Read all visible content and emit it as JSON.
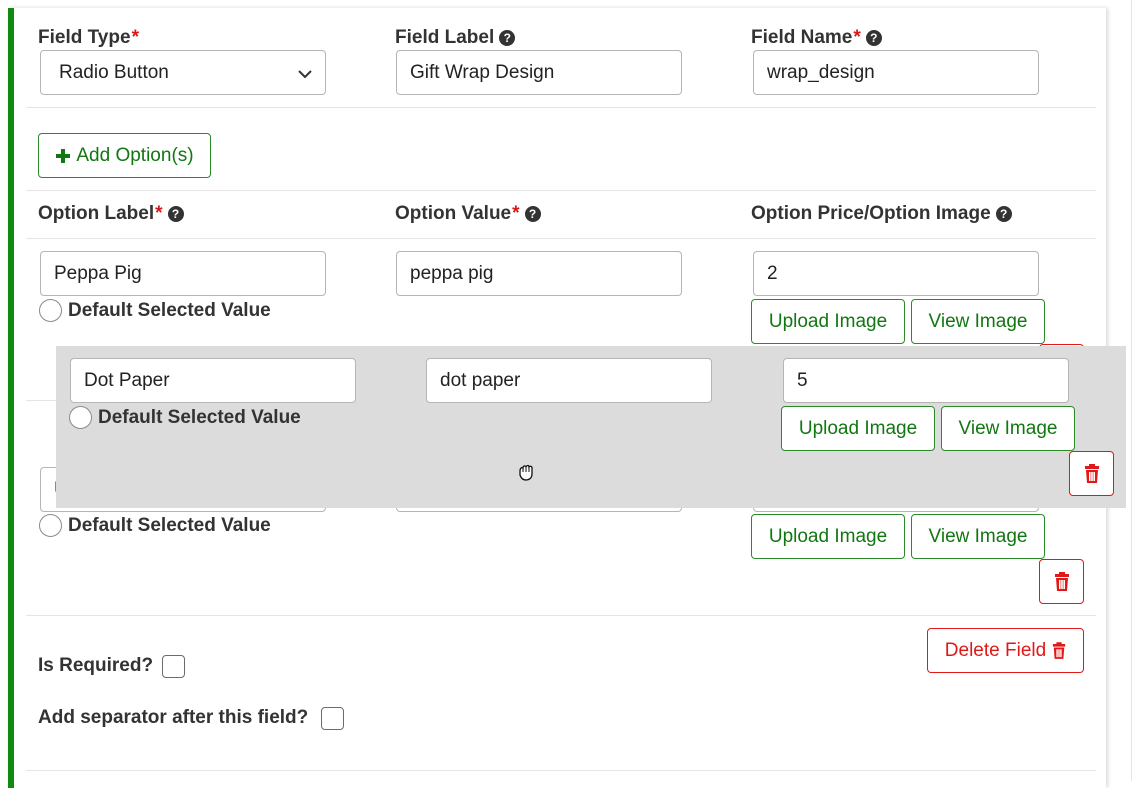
{
  "field": {
    "type_label": "Field Type",
    "type_value": "Radio Button",
    "label_label": "Field Label",
    "label_value": "Gift Wrap Design",
    "name_label": "Field Name",
    "name_value": "wrap_design",
    "required_mark": "*",
    "help_glyph": "?"
  },
  "options_header": {
    "add_button": "Add Option(s)",
    "option_label": "Option Label",
    "option_value": "Option Value",
    "option_price": "Option Price/Option Image"
  },
  "options": [
    {
      "label": "Peppa Pig",
      "value": "peppa pig",
      "price": "2",
      "default_text": "Default Selected Value",
      "upload": "Upload Image",
      "view": "View Image"
    },
    {
      "label": "Dot Paper",
      "value": "dot paper",
      "price": "5",
      "default_text": "Default Selected Value",
      "upload": "Upload Image",
      "view": "View Image"
    },
    {
      "label": "U",
      "value": "",
      "price": "",
      "default_text": "Default Selected Value",
      "upload": "Upload Image",
      "view": "View Image"
    }
  ],
  "footer": {
    "delete_field": "Delete Field",
    "is_required": "Is Required?",
    "add_separator": "Add separator after this field?"
  },
  "colors": {
    "accent_green": "#128a12",
    "danger_red": "#e01818",
    "drag_overlay": "#dcdcdc"
  },
  "icons": {
    "plus": "plus-icon",
    "help": "question-circle-icon",
    "trash": "trash-icon",
    "chevron": "chevron-down-icon",
    "cursor": "grab-hand-cursor-icon"
  }
}
